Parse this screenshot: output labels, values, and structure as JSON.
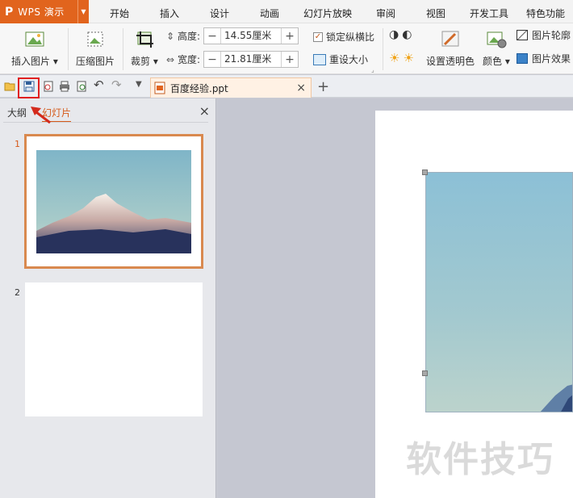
{
  "app": {
    "logo": "P",
    "name": "WPS 演示",
    "dropdown": "▼"
  },
  "menu": [
    "开始",
    "插入",
    "设计",
    "动画",
    "幻灯片放映",
    "审阅",
    "视图",
    "开发工具",
    "特色功能"
  ],
  "ribbon": {
    "insert_picture": "插入图片",
    "compress_picture": "压缩图片",
    "crop": "裁剪",
    "height_label": "高度:",
    "height_value": "14.55厘米",
    "width_label": "宽度:",
    "width_value": "21.81厘米",
    "lock_aspect": "锁定纵横比",
    "lock_aspect_checked": true,
    "reset_size": "重设大小",
    "set_transparent": "设置透明色",
    "color": "颜色",
    "picture_outline": "图片轮廓",
    "picture_effect": "图片效果",
    "minus": "−",
    "plus": "+",
    "dropdown": "▾"
  },
  "document_tab": {
    "name": "百度经验.ppt",
    "close": "×",
    "new_tab": "+"
  },
  "left_pane": {
    "tabs": [
      "大纲",
      "幻灯片"
    ],
    "active_tab": "幻灯片",
    "close": "×",
    "slides": [
      {
        "number": "1"
      },
      {
        "number": "2"
      }
    ]
  },
  "watermark": "软件技巧",
  "colors": {
    "accent": "#e1641d",
    "highlight_box": "#e02020",
    "arrow": "#d42a1c"
  }
}
